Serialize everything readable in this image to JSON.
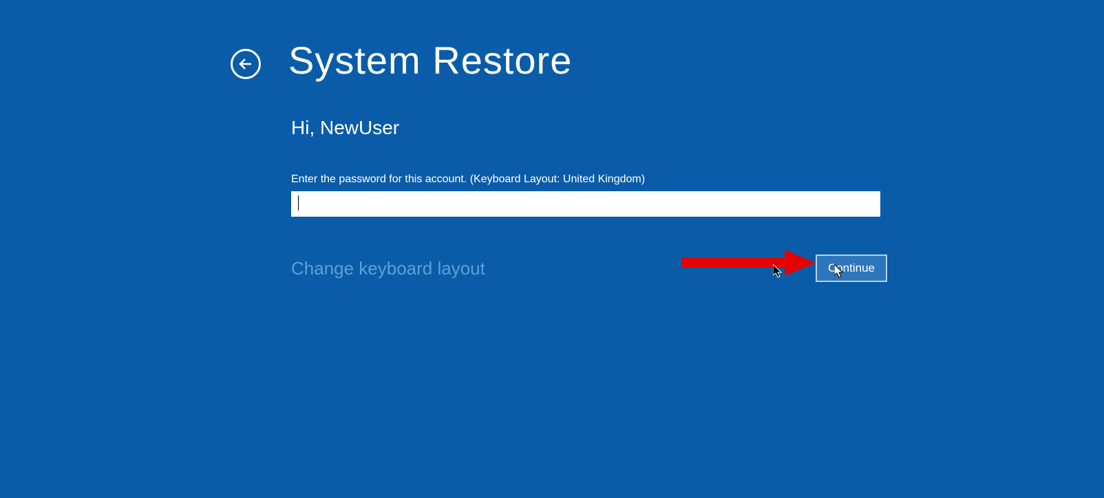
{
  "header": {
    "title": "System Restore"
  },
  "content": {
    "greeting": "Hi, NewUser",
    "password_label": "Enter the password for this account. (Keyboard Layout: United Kingdom)",
    "password_value": "",
    "change_keyboard_link": "Change keyboard layout",
    "continue_button": "Continue"
  }
}
